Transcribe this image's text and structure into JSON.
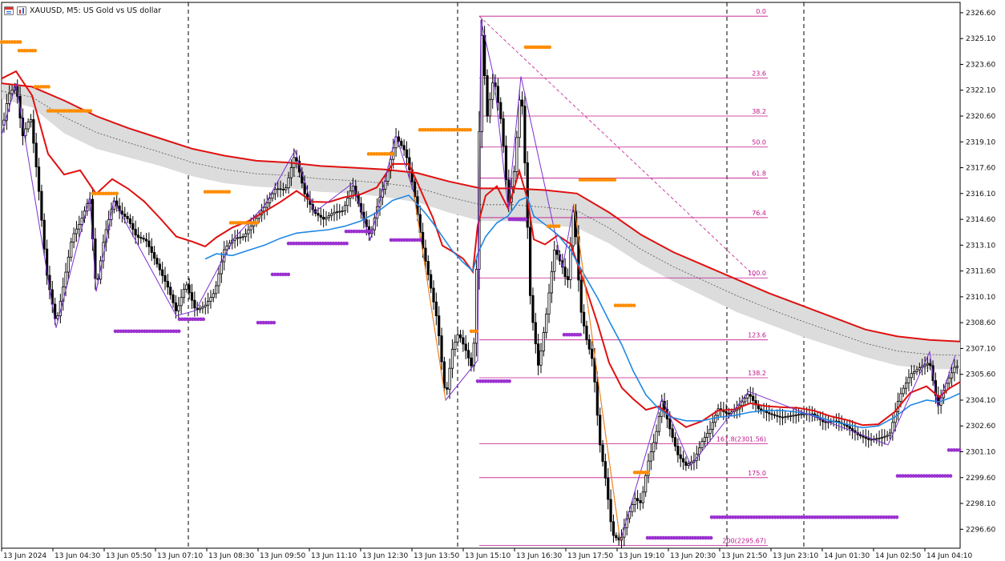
{
  "window": {
    "title": "XAUUSD, M5:  US Gold vs US dollar",
    "icons": [
      "chart-window-icon",
      "chart-bars-icon"
    ]
  },
  "colors": {
    "fast_ma": "#1e88e5",
    "slow_ma": "#e01010",
    "mid_ma": "#555555",
    "band_fill": "#dcdcdc",
    "resistance_dots": "#ff8c00",
    "support_dots": "#9b30d0",
    "zigzag": "#7b2fd0",
    "zigzag_down": "#ff8c00",
    "fibo": "#c0148c",
    "candle": "#000000",
    "grid_separator": "#000000"
  },
  "chart_data": {
    "type": "candlestick",
    "symbol": "XAUUSD",
    "timeframe": "M5",
    "ylim": [
      2295.5,
      2327.2
    ],
    "xlim": [
      0,
      1198
    ],
    "y_ticks": [
      "2326.60",
      "2325.10",
      "2323.60",
      "2322.10",
      "2320.60",
      "2319.10",
      "2317.60",
      "2316.10",
      "2314.60",
      "2313.10",
      "2311.60",
      "2310.10",
      "2308.60",
      "2307.10",
      "2305.60",
      "2304.10",
      "2302.60",
      "2301.10",
      "2299.60",
      "2298.10",
      "2296.60"
    ],
    "x_labels": [
      {
        "x": 2,
        "label": "13 Jun 2024"
      },
      {
        "x": 66,
        "label": "13 Jun 04:30"
      },
      {
        "x": 130,
        "label": "13 Jun 05:50"
      },
      {
        "x": 194,
        "label": "13 Jun 07:10"
      },
      {
        "x": 258,
        "label": "13 Jun 08:30"
      },
      {
        "x": 322,
        "label": "13 Jun 09:50"
      },
      {
        "x": 386,
        "label": "13 Jun 11:10"
      },
      {
        "x": 450,
        "label": "13 Jun 12:30"
      },
      {
        "x": 514,
        "label": "13 Jun 13:50"
      },
      {
        "x": 578,
        "label": "13 Jun 15:10"
      },
      {
        "x": 642,
        "label": "13 Jun 16:30"
      },
      {
        "x": 706,
        "label": "13 Jun 17:50"
      },
      {
        "x": 770,
        "label": "13 Jun 19:10"
      },
      {
        "x": 834,
        "label": "13 Jun 20:30"
      },
      {
        "x": 898,
        "label": "13 Jun 21:50"
      },
      {
        "x": 962,
        "label": "13 Jun 23:10"
      },
      {
        "x": 1026,
        "label": "14 Jun 01:30"
      },
      {
        "x": 1090,
        "label": "14 Jun 02:50"
      },
      {
        "x": 1154,
        "label": "14 Jun 04:10"
      }
    ],
    "separators": [
      235,
      571,
      907,
      1003
    ],
    "price_path": [
      [
        2,
        2319.5
      ],
      [
        10,
        2321.8
      ],
      [
        20,
        2322.4
      ],
      [
        28,
        2319.4
      ],
      [
        38,
        2320.6
      ],
      [
        48,
        2316.5
      ],
      [
        58,
        2311.5
      ],
      [
        70,
        2308.5
      ],
      [
        80,
        2311.0
      ],
      [
        90,
        2313.6
      ],
      [
        100,
        2314.4
      ],
      [
        112,
        2315.9
      ],
      [
        120,
        2310.4
      ],
      [
        130,
        2313.6
      ],
      [
        142,
        2315.7
      ],
      [
        150,
        2315.0
      ],
      [
        160,
        2314.6
      ],
      [
        170,
        2313.6
      ],
      [
        182,
        2313.4
      ],
      [
        196,
        2312.0
      ],
      [
        210,
        2310.6
      ],
      [
        220,
        2309.2
      ],
      [
        232,
        2310.9
      ],
      [
        244,
        2309.3
      ],
      [
        256,
        2309.6
      ],
      [
        268,
        2310.4
      ],
      [
        280,
        2312.9
      ],
      [
        292,
        2313.5
      ],
      [
        304,
        2313.6
      ],
      [
        316,
        2314.4
      ],
      [
        330,
        2315.3
      ],
      [
        344,
        2316.4
      ],
      [
        356,
        2316.3
      ],
      [
        368,
        2318.4
      ],
      [
        380,
        2316.1
      ],
      [
        392,
        2315.0
      ],
      [
        404,
        2314.6
      ],
      [
        416,
        2315.0
      ],
      [
        428,
        2315.1
      ],
      [
        440,
        2316.6
      ],
      [
        452,
        2314.8
      ],
      [
        462,
        2313.6
      ],
      [
        472,
        2315.6
      ],
      [
        482,
        2317.0
      ],
      [
        494,
        2319.4
      ],
      [
        506,
        2318.5
      ],
      [
        516,
        2316.4
      ],
      [
        526,
        2313.3
      ],
      [
        536,
        2311.0
      ],
      [
        546,
        2308.6
      ],
      [
        556,
        2304.1
      ],
      [
        564,
        2307.0
      ],
      [
        572,
        2308.0
      ],
      [
        582,
        2306.9
      ],
      [
        590,
        2305.8
      ],
      [
        596,
        2313.5
      ],
      [
        600,
        2326.2
      ],
      [
        608,
        2320.6
      ],
      [
        616,
        2322.9
      ],
      [
        626,
        2320.1
      ],
      [
        634,
        2315.4
      ],
      [
        642,
        2317.5
      ],
      [
        650,
        2322.7
      ],
      [
        656,
        2316.8
      ],
      [
        662,
        2309.7
      ],
      [
        672,
        2306.0
      ],
      [
        682,
        2309.2
      ],
      [
        692,
        2312.9
      ],
      [
        702,
        2311.8
      ],
      [
        708,
        2310.8
      ],
      [
        716,
        2315.5
      ],
      [
        724,
        2309.5
      ],
      [
        732,
        2307.6
      ],
      [
        740,
        2306.3
      ],
      [
        748,
        2301.7
      ],
      [
        756,
        2299.4
      ],
      [
        764,
        2296.3
      ],
      [
        774,
        2295.9
      ],
      [
        782,
        2297.2
      ],
      [
        792,
        2298.4
      ],
      [
        800,
        2298.1
      ],
      [
        808,
        2300.4
      ],
      [
        818,
        2302.0
      ],
      [
        826,
        2304.1
      ],
      [
        836,
        2302.4
      ],
      [
        846,
        2300.9
      ],
      [
        856,
        2300.3
      ],
      [
        866,
        2300.6
      ],
      [
        876,
        2301.7
      ],
      [
        886,
        2302.4
      ],
      [
        896,
        2303.6
      ],
      [
        908,
        2303.3
      ],
      [
        920,
        2303.6
      ],
      [
        934,
        2304.5
      ],
      [
        946,
        2303.6
      ],
      [
        960,
        2303.3
      ],
      [
        974,
        2303.1
      ],
      [
        988,
        2303.2
      ],
      [
        1000,
        2303.3
      ],
      [
        1014,
        2303.3
      ],
      [
        1028,
        2302.8
      ],
      [
        1042,
        2302.9
      ],
      [
        1056,
        2302.6
      ],
      [
        1070,
        2302.1
      ],
      [
        1084,
        2301.8
      ],
      [
        1098,
        2301.9
      ],
      [
        1110,
        2302.1
      ],
      [
        1122,
        2304.3
      ],
      [
        1136,
        2305.6
      ],
      [
        1148,
        2306.0
      ],
      [
        1160,
        2306.3
      ],
      [
        1170,
        2303.7
      ],
      [
        1180,
        2305.0
      ],
      [
        1192,
        2306.1
      ],
      [
        1198,
        2306.0
      ]
    ],
    "fast_ma": [
      [
        2,
        2322.0
      ],
      [
        20,
        2321.6
      ],
      [
        40,
        2320.6
      ],
      [
        60,
        2319.0
      ],
      [
        80,
        2317.4
      ],
      [
        100,
        2316.6
      ],
      [
        120,
        2316.1
      ],
      [
        140,
        2315.6
      ],
      [
        160,
        2315.1
      ],
      [
        180,
        2314.5
      ],
      [
        200,
        2313.8
      ],
      [
        220,
        2313.2
      ],
      [
        240,
        2312.6
      ],
      [
        256,
        2312.3
      ],
      [
        270,
        2312.6
      ],
      [
        290,
        2312.5
      ],
      [
        310,
        2312.8
      ],
      [
        330,
        2313.1
      ],
      [
        350,
        2313.5
      ],
      [
        370,
        2313.8
      ],
      [
        390,
        2313.9
      ],
      [
        410,
        2314.0
      ],
      [
        430,
        2314.2
      ],
      [
        450,
        2314.5
      ],
      [
        470,
        2315.0
      ],
      [
        490,
        2315.7
      ],
      [
        510,
        2316.0
      ],
      [
        520,
        2315.5
      ],
      [
        530,
        2315.0
      ],
      [
        540,
        2314.4
      ],
      [
        552,
        2313.6
      ],
      [
        564,
        2312.8
      ],
      [
        578,
        2312.1
      ],
      [
        590,
        2311.6
      ],
      [
        596,
        2312.6
      ],
      [
        606,
        2313.6
      ],
      [
        620,
        2314.4
      ],
      [
        634,
        2314.8
      ],
      [
        648,
        2315.7
      ],
      [
        658,
        2315.9
      ],
      [
        666,
        2314.8
      ],
      [
        680,
        2314.3
      ],
      [
        696,
        2313.7
      ],
      [
        712,
        2312.8
      ],
      [
        730,
        2311.3
      ],
      [
        746,
        2310.0
      ],
      [
        760,
        2308.7
      ],
      [
        776,
        2307.3
      ],
      [
        790,
        2305.8
      ],
      [
        806,
        2304.4
      ],
      [
        822,
        2303.6
      ],
      [
        838,
        2303.1
      ],
      [
        856,
        2302.9
      ],
      [
        876,
        2302.9
      ],
      [
        896,
        2303.1
      ],
      [
        916,
        2303.2
      ],
      [
        936,
        2303.4
      ],
      [
        956,
        2303.5
      ],
      [
        976,
        2303.5
      ],
      [
        996,
        2303.4
      ],
      [
        1016,
        2303.2
      ],
      [
        1036,
        2302.9
      ],
      [
        1056,
        2302.7
      ],
      [
        1076,
        2302.5
      ],
      [
        1096,
        2302.6
      ],
      [
        1116,
        2303.1
      ],
      [
        1136,
        2303.8
      ],
      [
        1156,
        2304.1
      ],
      [
        1172,
        2304.0
      ],
      [
        1184,
        2304.2
      ],
      [
        1198,
        2304.5
      ]
    ],
    "slow_ma": [
      [
        2,
        2322.5
      ],
      [
        40,
        2322.3
      ],
      [
        80,
        2321.5
      ],
      [
        120,
        2320.6
      ],
      [
        160,
        2319.9
      ],
      [
        200,
        2319.3
      ],
      [
        240,
        2318.7
      ],
      [
        280,
        2318.3
      ],
      [
        320,
        2318.0
      ],
      [
        360,
        2317.9
      ],
      [
        400,
        2317.7
      ],
      [
        440,
        2317.6
      ],
      [
        480,
        2317.5
      ],
      [
        520,
        2317.3
      ],
      [
        560,
        2316.8
      ],
      [
        600,
        2316.4
      ],
      [
        640,
        2316.4
      ],
      [
        680,
        2316.3
      ],
      [
        720,
        2316.1
      ],
      [
        760,
        2315.0
      ],
      [
        800,
        2313.7
      ],
      [
        840,
        2312.7
      ],
      [
        880,
        2311.9
      ],
      [
        920,
        2311.1
      ],
      [
        960,
        2310.3
      ],
      [
        1000,
        2309.6
      ],
      [
        1040,
        2308.9
      ],
      [
        1080,
        2308.2
      ],
      [
        1120,
        2307.8
      ],
      [
        1160,
        2307.6
      ],
      [
        1198,
        2307.5
      ]
    ],
    "band_low": [
      [
        2,
        2321.6
      ],
      [
        40,
        2321.1
      ],
      [
        80,
        2319.6
      ],
      [
        120,
        2318.7
      ],
      [
        160,
        2318.2
      ],
      [
        200,
        2317.7
      ],
      [
        240,
        2317.1
      ],
      [
        280,
        2316.7
      ],
      [
        320,
        2316.5
      ],
      [
        360,
        2316.4
      ],
      [
        400,
        2316.2
      ],
      [
        440,
        2316.1
      ],
      [
        480,
        2315.9
      ],
      [
        520,
        2315.6
      ],
      [
        560,
        2315.0
      ],
      [
        600,
        2314.5
      ],
      [
        640,
        2314.5
      ],
      [
        680,
        2314.3
      ],
      [
        720,
        2314.1
      ],
      [
        760,
        2313.2
      ],
      [
        800,
        2312.0
      ],
      [
        840,
        2311.0
      ],
      [
        880,
        2310.1
      ],
      [
        920,
        2309.2
      ],
      [
        960,
        2308.5
      ],
      [
        1000,
        2307.8
      ],
      [
        1040,
        2307.2
      ],
      [
        1080,
        2306.6
      ],
      [
        1120,
        2306.1
      ],
      [
        1160,
        2305.9
      ],
      [
        1198,
        2305.9
      ]
    ],
    "resistance_dots": [
      {
        "x1": 2,
        "x2": 26,
        "y": 2324.9
      },
      {
        "x1": 24,
        "x2": 44,
        "y": 2324.4
      },
      {
        "x1": 44,
        "x2": 62,
        "y": 2322.3
      },
      {
        "x1": 60,
        "x2": 116,
        "y": 2320.9
      },
      {
        "x1": 116,
        "x2": 146,
        "y": 2316.1
      },
      {
        "x1": 256,
        "x2": 288,
        "y": 2316.2
      },
      {
        "x1": 288,
        "x2": 322,
        "y": 2314.4
      },
      {
        "x1": 460,
        "x2": 490,
        "y": 2318.4
      },
      {
        "x1": 524,
        "x2": 588,
        "y": 2319.8
      },
      {
        "x1": 588,
        "x2": 596,
        "y": 2308.1
      },
      {
        "x1": 656,
        "x2": 686,
        "y": 2324.6
      },
      {
        "x1": 684,
        "x2": 698,
        "y": 2314.2
      },
      {
        "x1": 724,
        "x2": 768,
        "y": 2316.9
      },
      {
        "x1": 768,
        "x2": 794,
        "y": 2309.6
      },
      {
        "x1": 792,
        "x2": 810,
        "y": 2299.9
      }
    ],
    "support_dots": [
      {
        "x1": 144,
        "x2": 224,
        "y": 2308.1
      },
      {
        "x1": 224,
        "x2": 256,
        "y": 2308.8
      },
      {
        "x1": 322,
        "x2": 342,
        "y": 2308.6
      },
      {
        "x1": 340,
        "x2": 360,
        "y": 2311.4
      },
      {
        "x1": 360,
        "x2": 434,
        "y": 2313.2
      },
      {
        "x1": 432,
        "x2": 462,
        "y": 2313.9
      },
      {
        "x1": 488,
        "x2": 526,
        "y": 2313.4
      },
      {
        "x1": 596,
        "x2": 636,
        "y": 2305.2
      },
      {
        "x1": 636,
        "x2": 656,
        "y": 2314.6
      },
      {
        "x1": 704,
        "x2": 726,
        "y": 2307.9
      },
      {
        "x1": 808,
        "x2": 888,
        "y": 2296.1
      },
      {
        "x1": 888,
        "x2": 1122,
        "y": 2297.3
      },
      {
        "x1": 1120,
        "x2": 1186,
        "y": 2299.7
      },
      {
        "x1": 1184,
        "x2": 1198,
        "y": 2301.2
      }
    ],
    "zigzag": [
      [
        2,
        2319.5
      ],
      [
        20,
        2322.5
      ],
      [
        70,
        2308.3
      ],
      [
        112,
        2315.9
      ],
      [
        120,
        2310.4
      ],
      [
        142,
        2315.7
      ],
      [
        220,
        2309.0
      ],
      [
        244,
        2309.3
      ],
      [
        292,
        2313.5
      ],
      [
        330,
        2315.4
      ],
      [
        368,
        2318.6
      ],
      [
        392,
        2315.0
      ],
      [
        440,
        2316.7
      ],
      [
        462,
        2313.4
      ],
      [
        494,
        2319.5
      ],
      [
        516,
        2316.2
      ],
      [
        556,
        2304.1
      ],
      [
        596,
        2306.4
      ],
      [
        600,
        2326.2
      ],
      [
        616,
        2322.9
      ],
      [
        634,
        2315.2
      ],
      [
        650,
        2322.9
      ],
      [
        702,
        2311.8
      ],
      [
        716,
        2315.5
      ],
      [
        774,
        2295.9
      ],
      [
        826,
        2304.2
      ],
      [
        862,
        2300.3
      ],
      [
        934,
        2304.6
      ],
      [
        1108,
        2301.5
      ],
      [
        1160,
        2306.9
      ],
      [
        1170,
        2303.7
      ],
      [
        1192,
        2306.7
      ]
    ],
    "zigzag_down_legs": [
      [
        [
          516,
          2316.2
        ],
        [
          556,
          2304.1
        ]
      ],
      [
        [
          716,
          2315.5
        ],
        [
          774,
          2295.9
        ]
      ]
    ],
    "fibo": {
      "x1": 598,
      "x2": 958,
      "trend_from": [
        598,
        2326.4
      ],
      "trend_to": [
        944,
        2311.2
      ],
      "levels": [
        {
          "label": "0.0",
          "price": 2326.4
        },
        {
          "label": "23.6",
          "price": 2322.8
        },
        {
          "label": "38.2",
          "price": 2320.6
        },
        {
          "label": "50.0",
          "price": 2318.8
        },
        {
          "label": "61.8",
          "price": 2317.0
        },
        {
          "label": "76.4",
          "price": 2314.7
        },
        {
          "label": "100.0",
          "price": 2311.2
        },
        {
          "label": "123.6",
          "price": 2307.6
        },
        {
          "label": "138.2",
          "price": 2305.4
        },
        {
          "label": "161.8(2301.56)",
          "price": 2301.56
        },
        {
          "label": "175.0",
          "price": 2299.6
        },
        {
          "label": "200(2295.67)",
          "price": 2295.67
        }
      ]
    }
  }
}
